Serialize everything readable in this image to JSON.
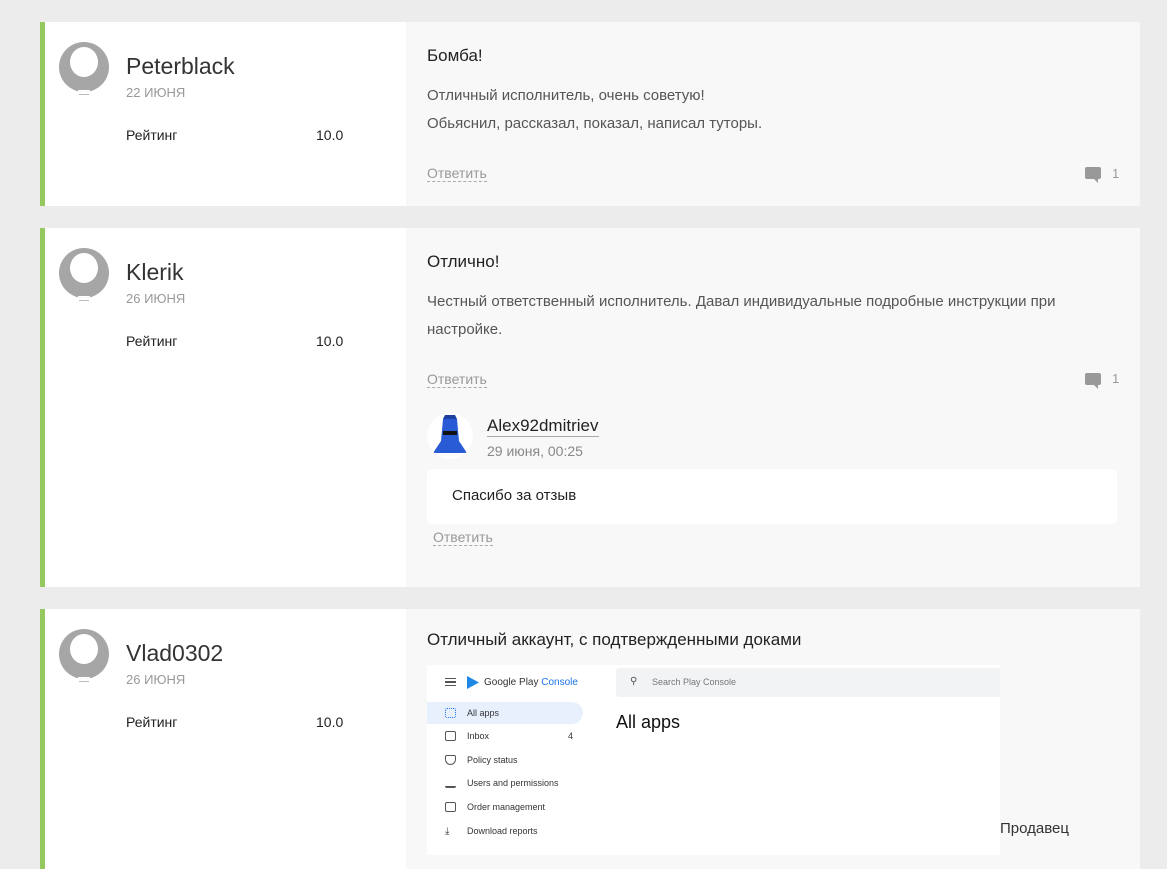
{
  "rating_label": "Рейтинг",
  "reply_label": "Ответить",
  "reviews": [
    {
      "author": "Peterblack",
      "date": "22 июня",
      "rating": "10.0",
      "title": "Бомба!",
      "text": [
        "Отличный исполнитель, очень советую!",
        "Обьяснил, рассказал, показал, написал туторы."
      ],
      "comments": "1"
    },
    {
      "author": "Klerik",
      "date": "26 июня",
      "rating": "10.0",
      "title": "Отлично!",
      "text": [
        "Честный ответственный исполнитель. Давал индивидуальные подробные инструкции при настройке."
      ],
      "comments": "1",
      "reply": {
        "author": "Alex92dmitriev",
        "date": "29 июня, 00:25",
        "text": "Спасибо за отзыв"
      }
    },
    {
      "author": "Vlad0302",
      "date": "26 июня",
      "rating": "10.0",
      "title": "Отличный аккаунт, с подтвержденными доками",
      "screenshot": {
        "brand": "Google Play",
        "brand_accent": "Console",
        "search_placeholder": "Search Play Console",
        "heading": "All apps",
        "nav": [
          {
            "label": "All apps",
            "active": true
          },
          {
            "label": "Inbox",
            "badge": "4"
          },
          {
            "label": "Policy status"
          },
          {
            "label": "Users and permissions"
          },
          {
            "label": "Order management"
          },
          {
            "label": "Download reports"
          }
        ]
      }
    }
  ],
  "seller_label": "Продавец",
  "colors": {
    "accent_border": "#95c85f",
    "link": "#999999"
  }
}
